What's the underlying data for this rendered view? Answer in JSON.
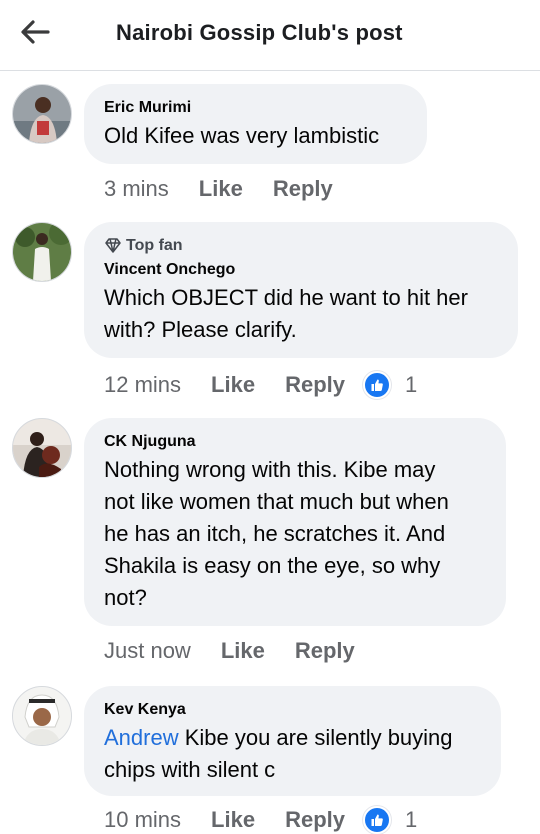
{
  "header": {
    "title": "Nairobi Gossip Club's post"
  },
  "comments": [
    {
      "name": "Eric Murimi",
      "text": "Old Kifee was very lambistic",
      "time": "3 mins",
      "like": "Like",
      "reply": "Reply"
    },
    {
      "badge": "Top fan",
      "name": "Vincent Onchego",
      "text_lines": [
        "Which OBJECT did he want to hit her",
        "with? Please clarify."
      ],
      "time": "12 mins",
      "like": "Like",
      "reply": "Reply",
      "reaction_count": "1"
    },
    {
      "name": "CK Njuguna",
      "text_lines": [
        "Nothing wrong with this. Kibe may",
        "not like women that much but when",
        "he has an itch, he scratches it. And",
        "Shakila is easy on the eye, so why",
        "not?"
      ],
      "time": "Just now",
      "like": "Like",
      "reply": "Reply"
    },
    {
      "name": "Kev Kenya",
      "mention": "Andrew",
      "text_line1_rest": " Kibe you are silently buying",
      "text_line2": "chips with silent c",
      "time": "10 mins",
      "like": "Like",
      "reply": "Reply",
      "reaction_count": "1"
    }
  ],
  "colors": {
    "bubble": "#f0f2f5",
    "meta": "#65676b",
    "link": "#216fdb",
    "like_blue": "#1877f2"
  }
}
